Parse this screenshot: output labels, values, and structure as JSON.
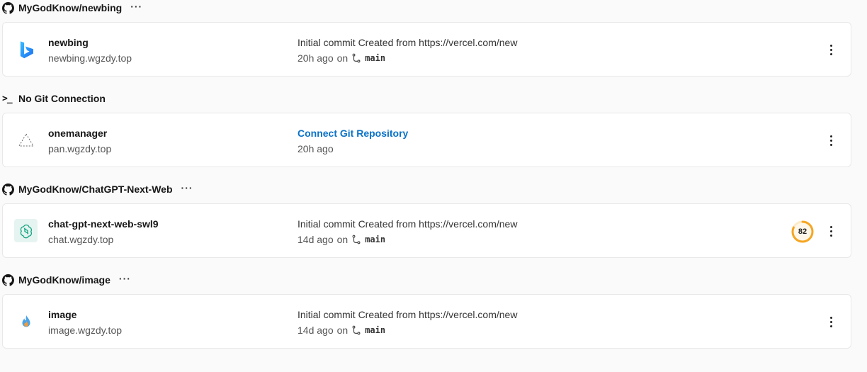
{
  "groups": [
    {
      "header": "MyGodKnow/newbing",
      "header_icon": "github-icon",
      "project": {
        "name": "newbing",
        "domain": "newbing.wgzdy.top",
        "logo": "bing-logo",
        "commit": "Initial commit Created from https://vercel.com/new",
        "age": "20h ago",
        "on": "on",
        "branch": "main"
      }
    },
    {
      "header": "No Git Connection",
      "header_icon": "terminal-icon",
      "header_glyph": ">_",
      "project": {
        "name": "onemanager",
        "domain": "pan.wgzdy.top",
        "logo": "triangle-placeholder-icon",
        "commit": "Connect Git Repository",
        "age": "20h ago"
      }
    },
    {
      "header": "MyGodKnow/ChatGPT-Next-Web",
      "header_icon": "github-icon",
      "project": {
        "name": "chat-gpt-next-web-swl9",
        "domain": "chat.wgzdy.top",
        "logo": "openai-logo",
        "commit": "Initial commit Created from https://vercel.com/new",
        "age": "14d ago",
        "on": "on",
        "branch": "main",
        "score": "82",
        "score_fraction": 0.82,
        "score_color": "#f5a623"
      }
    },
    {
      "header": "MyGodKnow/image",
      "header_icon": "github-icon",
      "project": {
        "name": "image",
        "domain": "image.wgzdy.top",
        "logo": "flame-logo",
        "commit": "Initial commit Created from https://vercel.com/new",
        "age": "14d ago",
        "on": "on",
        "branch": "main"
      }
    }
  ],
  "colors": {
    "link": "#0a72c7",
    "score_ring": "#f5a623"
  }
}
